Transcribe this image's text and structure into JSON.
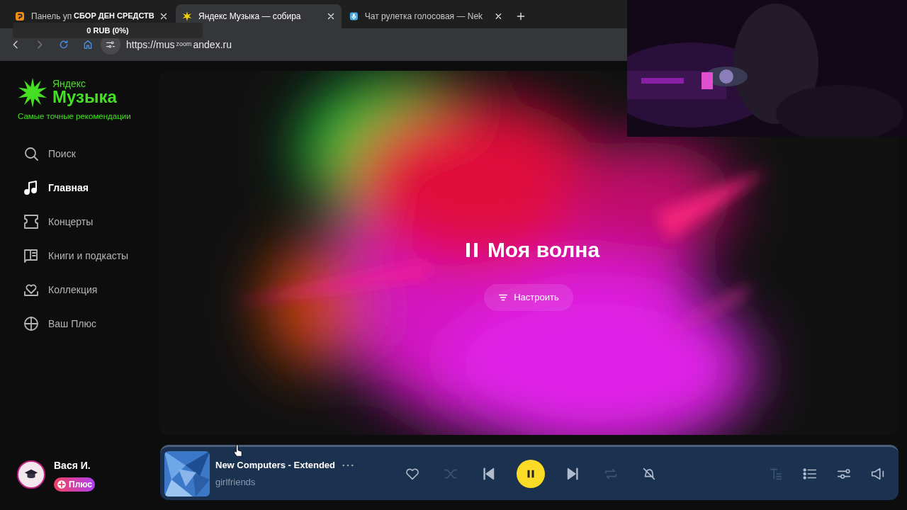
{
  "browser": {
    "tabs": [
      {
        "title": "Панель уп",
        "selected": false
      },
      {
        "title": "Яндекс Музыка — собира",
        "selected": true
      },
      {
        "title": "Чат рулетка голосовая — Nek",
        "selected": false
      }
    ],
    "overlay": {
      "title": "СБОР ДЕН СРЕДСТВ",
      "amount": "0 RUB (0%)"
    },
    "url_start": "https://mus",
    "url_end": "andex.ru",
    "url_overlay": "zoom"
  },
  "logo": {
    "line1": "Яндекс",
    "line2": "Музыка",
    "tagline": "Самые точные рекомендации"
  },
  "nav": [
    {
      "label": "Поиск",
      "selected": false
    },
    {
      "label": "Главная",
      "selected": true
    },
    {
      "label": "Концерты",
      "selected": false
    },
    {
      "label": "Книги и подкасты",
      "selected": false
    },
    {
      "label": "Коллекция",
      "selected": false
    },
    {
      "label": "Ваш Плюс",
      "selected": false
    }
  ],
  "wave": {
    "title": "Моя волна",
    "playing": true,
    "settings_button": "Настроить"
  },
  "user": {
    "name": "Вася И.",
    "badge": "Плюс"
  },
  "player": {
    "track": "New Computers - Extended",
    "artist": "girlfriends",
    "playing": true,
    "liked": false
  }
}
